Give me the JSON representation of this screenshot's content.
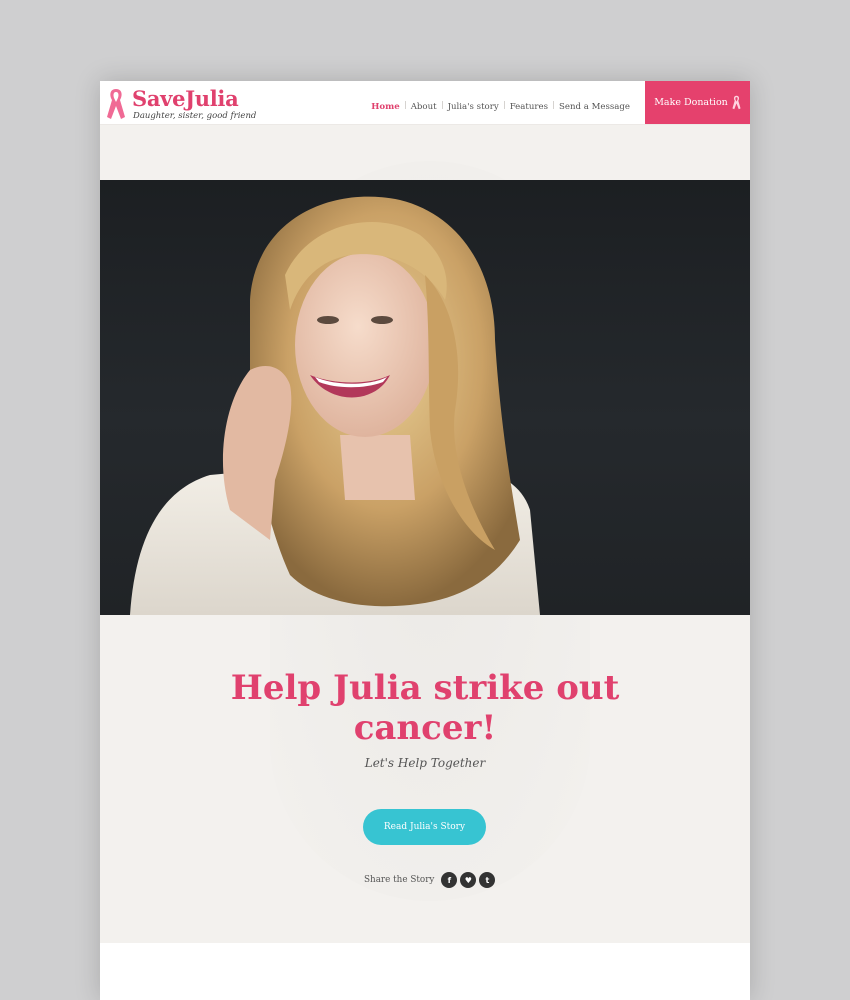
{
  "brand": {
    "title": "SaveJulia",
    "tagline": "Daughter, sister, good friend",
    "accent": "#e0416e",
    "cta_color": "#37c4d2"
  },
  "nav": {
    "items": [
      {
        "label": "Home",
        "active": true
      },
      {
        "label": "About"
      },
      {
        "label": "Julia's story"
      },
      {
        "label": "Features"
      },
      {
        "label": "Send a Message"
      }
    ],
    "donate_label": "Make Donation",
    "donate_icon": "ribbon-icon"
  },
  "hero": {
    "headline_line1": "Help Julia strike out",
    "headline_line2": "cancer!",
    "tagline": "Let's Help Together",
    "cta_label": "Read Julia's Story"
  },
  "share": {
    "label": "Share the Story",
    "icons": [
      {
        "name": "facebook-icon",
        "glyph": "f"
      },
      {
        "name": "twitter-icon",
        "glyph": "♥"
      },
      {
        "name": "tumblr-icon",
        "glyph": "t"
      }
    ]
  }
}
